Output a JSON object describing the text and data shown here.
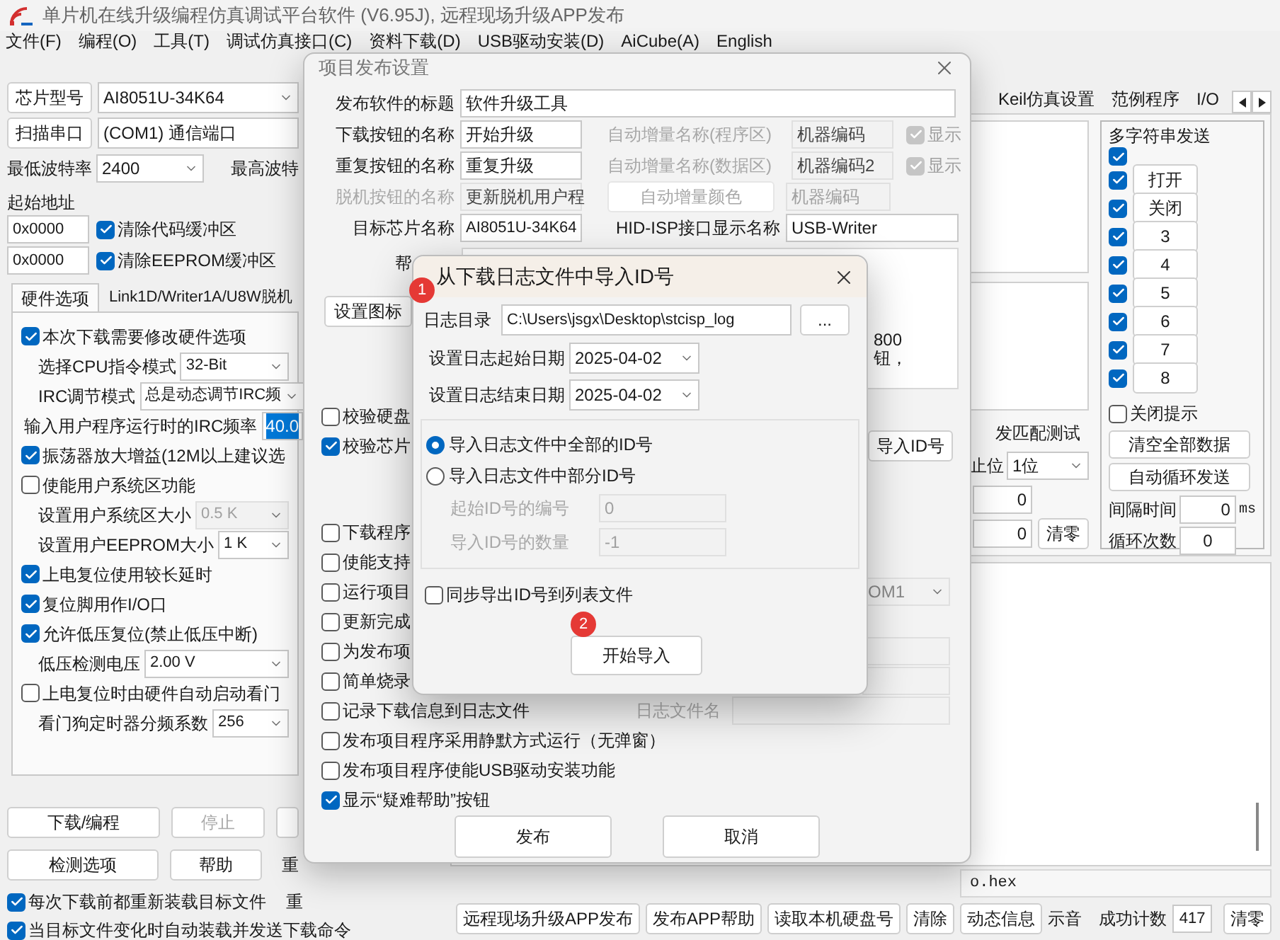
{
  "main_window": {
    "title": "单片机在线升级编程仿真调试平台软件 (V6.95J), 远程现场升级APP发布",
    "menu": [
      "文件(F)",
      "编程(O)",
      "工具(T)",
      "调试仿真接口(C)",
      "资料下载(D)",
      "USB驱动安装(D)",
      "AiCube(A)",
      "English"
    ],
    "left": {
      "chip_button": "芯片型号",
      "chip_value": "AI8051U-34K64",
      "scan_button": "扫描串口",
      "port_value": "(COM1) 通信端口",
      "min_baud_label": "最低波特率",
      "min_baud_value": "2400",
      "max_baud_label": "最高波特",
      "start_address_label": "起始地址",
      "address_rows": [
        {
          "value": "0x0000",
          "label": "清除代码缓冲区",
          "checked": true
        },
        {
          "value": "0x0000",
          "label": "清除EEPROM缓冲区",
          "checked": true
        }
      ],
      "tabs": [
        {
          "label": "硬件选项",
          "selected": true
        },
        {
          "label": "Link1D/Writer1A/U8W脱机",
          "selected": false
        }
      ],
      "hardware_options": [
        {
          "kind": "check",
          "label": "本次下载需要修改硬件选项",
          "checked": true
        },
        {
          "kind": "select",
          "label": "选择CPU指令模式",
          "value": "32-Bit",
          "disabled": false
        },
        {
          "kind": "select",
          "label": "IRC调节模式",
          "value": "总是动态调节IRC频",
          "disabled": false
        },
        {
          "kind": "input",
          "label": "输入用户程序运行时的IRC频率",
          "value": "40.0",
          "highlighted": true
        },
        {
          "kind": "check",
          "label": "振荡器放大增益(12M以上建议选",
          "checked": true
        },
        {
          "kind": "check",
          "label": "使能用户系统区功能",
          "checked": false
        },
        {
          "kind": "select",
          "label": "设置用户系统区大小",
          "value": "0.5 K",
          "disabled": true
        },
        {
          "kind": "select",
          "label": "设置用户EEPROM大小",
          "value": "1 K",
          "disabled": false
        },
        {
          "kind": "check",
          "label": "上电复位使用较长延时",
          "checked": true
        },
        {
          "kind": "check",
          "label": "复位脚用作I/O口",
          "checked": true
        },
        {
          "kind": "check",
          "label": "允许低压复位(禁止低压中断)",
          "checked": true
        },
        {
          "kind": "select",
          "label": "低压检测电压",
          "value": "2.00 V",
          "disabled": false
        },
        {
          "kind": "check",
          "label": "上电复位时由硬件自动启动看门",
          "checked": false
        },
        {
          "kind": "select",
          "label": "看门狗定时器分频系数",
          "value": "256",
          "disabled": false
        }
      ],
      "action_buttons": [
        {
          "label": "下载/编程",
          "disabled": false
        },
        {
          "label": "停止",
          "disabled": true
        },
        {
          "label": "检测选项",
          "disabled": false
        },
        {
          "label": "帮助",
          "disabled": false
        }
      ],
      "partial_labels": [
        "重",
        "重"
      ],
      "bottom_checks": [
        {
          "label": "每次下载前都重新装载目标文件",
          "checked": true
        },
        {
          "label": "当目标文件变化时自动装载并发送下载命令",
          "checked": true
        }
      ]
    },
    "right": {
      "tabs": [
        "Keil仿真设置",
        "范例程序",
        "I/O"
      ],
      "match_test_label": "发匹配测试",
      "stop_bits_label": "止位",
      "stop_bits_value": "1位",
      "counters": [
        "0",
        "0"
      ],
      "counter_clear_button": "清零",
      "multi_send": {
        "title": "多字符串发送",
        "rows": [
          {
            "checked": true
          },
          {
            "checked": true,
            "label": "打开"
          },
          {
            "checked": true,
            "label": "关闭"
          },
          {
            "checked": true,
            "label": "3"
          },
          {
            "checked": true,
            "label": "4"
          },
          {
            "checked": true,
            "label": "5"
          },
          {
            "checked": true,
            "label": "6"
          },
          {
            "checked": true,
            "label": "7"
          },
          {
            "checked": true,
            "label": "8"
          }
        ],
        "close_hint": {
          "label": "关闭提示",
          "checked": false
        },
        "buttons": [
          "清空全部数据",
          "自动循环发送"
        ],
        "interval_label": "间隔时间",
        "interval_value": "0",
        "interval_unit": "ms",
        "loop_label": "循环次数",
        "loop_value": "0"
      },
      "file_path": "o.hex"
    },
    "bottom_bar": {
      "buttons": [
        "远程现场升级APP发布",
        "发布APP帮助",
        "读取本机硬盘号",
        "清除",
        "动态信息"
      ],
      "sound_label": "示音",
      "success_label": "成功计数",
      "success_value": "417",
      "clear_button": "清零"
    }
  },
  "publish_dialog": {
    "title": "项目发布设置",
    "software_title": {
      "label": "发布软件的标题",
      "value": "软件升级工具"
    },
    "download_name": {
      "label": "下载按钮的名称",
      "value": "开始升级"
    },
    "repeat_name": {
      "label": "重复按钮的名称",
      "value": "重复升级"
    },
    "offline_name": {
      "label": "脱机按钮的名称",
      "value": "更新脱机用户程",
      "disabled": true
    },
    "target_chip": {
      "label": "目标芯片名称",
      "value": "AI8051U-34K64"
    },
    "auto_increment": [
      {
        "label": "自动增量名称(程序区)",
        "value": "机器编码",
        "show_label": "显示",
        "checked": true,
        "disabled": true
      },
      {
        "label": "自动增量名称(数据区)",
        "value": "机器编码2",
        "show_label": "显示",
        "checked": true,
        "disabled": true
      }
    ],
    "color_button": {
      "label": "自动增量颜色",
      "disabled": true
    },
    "color_value": "机器编码",
    "hid_name": {
      "label": "HID-ISP接口显示名称",
      "value": "USB-Writer"
    },
    "help_label": "帮",
    "help_text_fragments": [
      "800",
      "钮，"
    ],
    "icon_button": "设置图标",
    "verify_checks": [
      {
        "label": "校验硬盘",
        "checked": false
      },
      {
        "label": "校验芯片",
        "checked": true
      }
    ],
    "import_id_button": "导入ID号",
    "option_checks": [
      {
        "label": "下载程序",
        "checked": false
      },
      {
        "label": "使能支持",
        "checked": false
      },
      {
        "label": "运行项目",
        "checked": false
      },
      {
        "label": "更新完成",
        "checked": false
      },
      {
        "label": "为发布项",
        "checked": false
      },
      {
        "label": "简单烧录",
        "checked": false
      }
    ],
    "port_value": "OM1",
    "log_check": {
      "label": "记录下载信息到日志文件",
      "checked": false
    },
    "log_file_label": "日志文件名",
    "more_checks": [
      {
        "label": "发布项目程序采用静默方式运行（无弹窗）",
        "checked": false
      },
      {
        "label": "发布项目程序使能USB驱动安装功能",
        "checked": false
      },
      {
        "label": "显示“疑难帮助”按钮",
        "checked": true
      }
    ],
    "buttons": [
      "发布",
      "取消"
    ]
  },
  "import_dialog": {
    "title": "从下载日志文件中导入ID号",
    "step_badges": [
      "1",
      "2"
    ],
    "log_dir_label": "日志目录",
    "log_dir_value": "C:\\Users\\jsgx\\Desktop\\stcisp_log",
    "browse_button": "...",
    "start_date": {
      "label": "设置日志起始日期",
      "value": "2025-04-02"
    },
    "end_date": {
      "label": "设置日志结束日期",
      "value": "2025-04-02"
    },
    "modes": [
      {
        "label": "导入日志文件中全部的ID号",
        "selected": true
      },
      {
        "label": "导入日志文件中部分ID号",
        "selected": false
      }
    ],
    "range_disabled": true,
    "range_fields": [
      {
        "label": "起始ID号的编号",
        "value": "0"
      },
      {
        "label": "导入ID号的数量",
        "value": "-1"
      }
    ],
    "sync_check": {
      "label": "同步导出ID号到列表文件",
      "checked": false
    },
    "start_button": "开始导入"
  }
}
